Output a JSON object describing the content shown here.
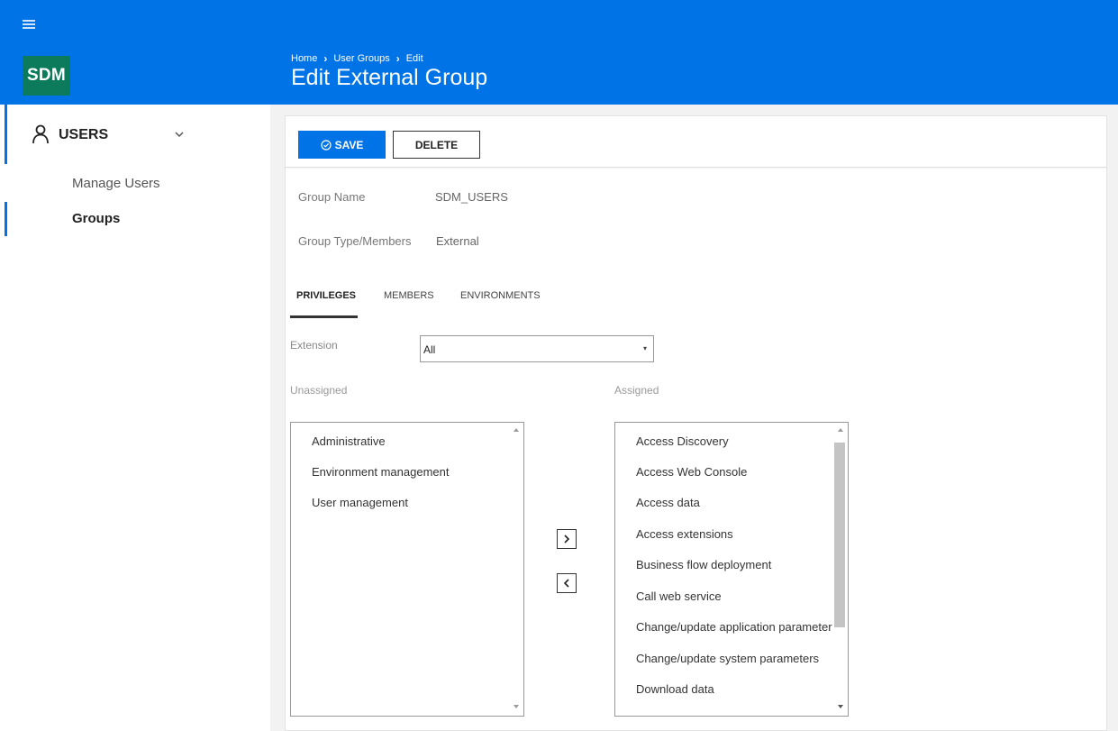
{
  "header": {
    "menu_icon": "hamburger-icon",
    "logo_text": "SDM",
    "breadcrumb": [
      "Home",
      "User Groups",
      "Edit"
    ],
    "title": "Edit External Group",
    "color": "#0073e7"
  },
  "sidebar": {
    "section_label": "USERS",
    "section_icon": "user-icon",
    "items": [
      {
        "label": "Manage Users",
        "active": false
      },
      {
        "label": "Groups",
        "active": true
      }
    ]
  },
  "toolbar": {
    "save_label": "SAVE",
    "delete_label": "DELETE"
  },
  "form": {
    "group_name_label": "Group Name",
    "group_name_value": "SDM_USERS",
    "group_type_label": "Group Type/Members",
    "group_type_value": "External"
  },
  "tabs": [
    {
      "label": "PRIVILEGES",
      "active": true
    },
    {
      "label": "MEMBERS",
      "active": false
    },
    {
      "label": "ENVIRONMENTS",
      "active": false
    }
  ],
  "filter": {
    "label": "Extension",
    "value": "All"
  },
  "unassigned": {
    "label": "Unassigned",
    "items": [
      "Administrative",
      "Environment management",
      "User management"
    ]
  },
  "assigned": {
    "label": "Assigned",
    "items": [
      "Access Discovery",
      "Access Web Console",
      "Access data",
      "Access extensions",
      "Business flow deployment",
      "Call web service",
      "Change/update application parameter",
      "Change/update system parameters",
      "Download data"
    ]
  }
}
